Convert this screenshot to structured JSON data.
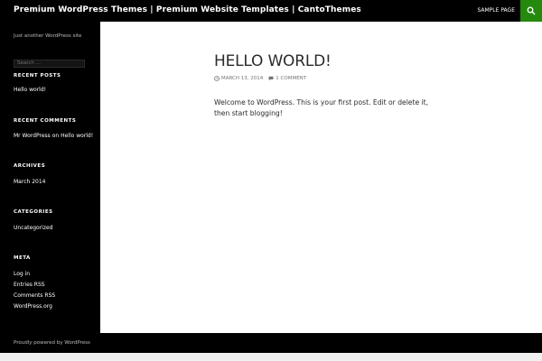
{
  "header": {
    "site_title": "Premium WordPress Themes | Premium Website Templates | CantoThemes",
    "nav_link": "SAMPLE PAGE"
  },
  "sidebar": {
    "tagline": "Just another WordPress site",
    "search_placeholder": "Search …",
    "recent_posts": {
      "title": "RECENT POSTS",
      "items": [
        "Hello world!"
      ]
    },
    "recent_comments": {
      "title": "RECENT COMMENTS",
      "author": "Mr WordPress",
      "connector": "on",
      "post": "Hello world!"
    },
    "archives": {
      "title": "ARCHIVES",
      "items": [
        "March 2014"
      ]
    },
    "categories": {
      "title": "CATEGORIES",
      "items": [
        "Uncategorized"
      ]
    },
    "meta": {
      "title": "META",
      "items": [
        "Log in",
        "Entries RSS",
        "Comments RSS",
        "WordPress.org"
      ]
    }
  },
  "post": {
    "title": "HELLO WORLD!",
    "date": "MARCH 13, 2014",
    "comments": "1 COMMENT",
    "content": "Welcome to WordPress. This is your first post. Edit or delete it, then start blogging!"
  },
  "footer": {
    "credit": "Proudly powered by WordPress"
  },
  "colors": {
    "accent": "#24890d",
    "background": "#000000",
    "content_bg": "#ffffff",
    "text": "#2b2b2b"
  },
  "icons": {
    "search": "search-icon",
    "date": "clock-icon",
    "comments": "comment-icon"
  }
}
